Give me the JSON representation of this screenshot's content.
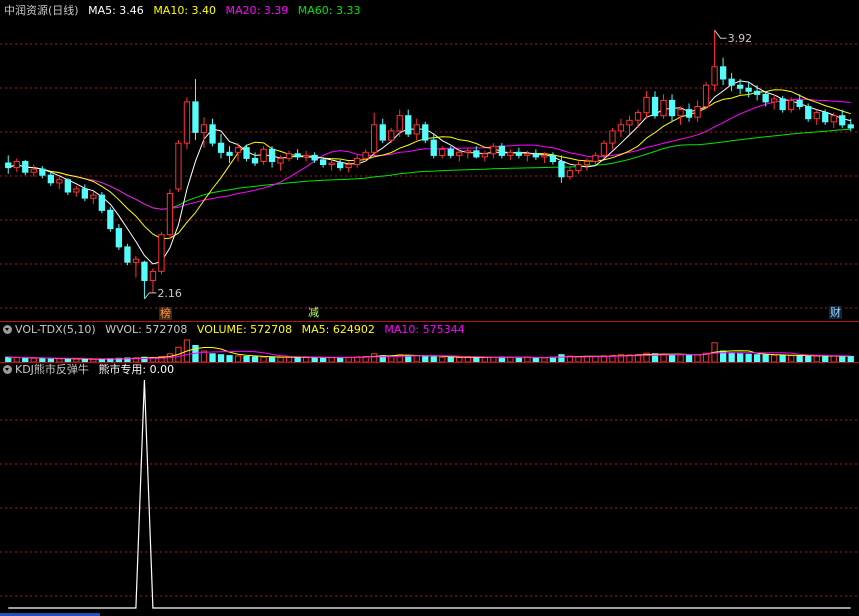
{
  "main": {
    "title": "中润资源(日线)",
    "ma5": "MA5: 3.46",
    "ma10": "MA10: 3.40",
    "ma20": "MA20: 3.39",
    "ma60": "MA60: 3.33",
    "high_label": "3.92",
    "low_label": "2.16",
    "events": [
      {
        "text": "榜"
      },
      {
        "text": "减"
      },
      {
        "text": "财"
      }
    ]
  },
  "volume": {
    "name": "VOL-TDX(5,10)",
    "wvol": "WVOL: 572708",
    "volume": "VOLUME: 572708",
    "ma5": "MA5: 624902",
    "ma10": "MA10: 575344"
  },
  "kdj": {
    "name": "KDJ熊市反弹牛",
    "line": "熊市专用: 0.00"
  },
  "colors": {
    "up": "#ff3232",
    "down": "#54fcfc",
    "ma5": "#ffffff",
    "ma10": "#ffff00",
    "ma20": "#ff00ff",
    "ma60": "#00e600",
    "grid": "#b41414"
  },
  "chart_data": {
    "type": "candlestick",
    "count": 100,
    "ohlc": [
      [
        3.05,
        3.1,
        2.98,
        3.02
      ],
      [
        3.02,
        3.08,
        2.99,
        3.06
      ],
      [
        3.06,
        3.07,
        2.97,
        2.99
      ],
      [
        2.99,
        3.04,
        2.96,
        3.01
      ],
      [
        3.01,
        3.03,
        2.95,
        2.97
      ],
      [
        2.97,
        2.99,
        2.9,
        2.92
      ],
      [
        2.92,
        2.96,
        2.88,
        2.94
      ],
      [
        2.94,
        2.95,
        2.84,
        2.86
      ],
      [
        2.86,
        2.9,
        2.83,
        2.88
      ],
      [
        2.88,
        2.91,
        2.8,
        2.82
      ],
      [
        2.82,
        2.86,
        2.78,
        2.84
      ],
      [
        2.84,
        2.86,
        2.72,
        2.74
      ],
      [
        2.74,
        2.76,
        2.6,
        2.62
      ],
      [
        2.62,
        2.65,
        2.48,
        2.5
      ],
      [
        2.5,
        2.52,
        2.38,
        2.4
      ],
      [
        2.4,
        2.44,
        2.3,
        2.42
      ],
      [
        2.4,
        2.41,
        2.16,
        2.28
      ],
      [
        2.28,
        2.36,
        2.2,
        2.34
      ],
      [
        2.34,
        2.6,
        2.32,
        2.58
      ],
      [
        2.58,
        2.88,
        2.55,
        2.85
      ],
      [
        2.88,
        3.2,
        2.86,
        3.18
      ],
      [
        3.18,
        3.48,
        3.14,
        3.45
      ],
      [
        3.45,
        3.6,
        3.2,
        3.25
      ],
      [
        3.25,
        3.35,
        3.15,
        3.3
      ],
      [
        3.3,
        3.34,
        3.16,
        3.18
      ],
      [
        3.18,
        3.24,
        3.08,
        3.12
      ],
      [
        3.12,
        3.16,
        3.05,
        3.1
      ],
      [
        3.12,
        3.18,
        3.06,
        3.15
      ],
      [
        3.15,
        3.17,
        3.06,
        3.08
      ],
      [
        3.08,
        3.12,
        3.03,
        3.05
      ],
      [
        3.06,
        3.16,
        3.04,
        3.14
      ],
      [
        3.14,
        3.16,
        3.02,
        3.06
      ],
      [
        3.05,
        3.1,
        3.0,
        3.08
      ],
      [
        3.08,
        3.13,
        3.06,
        3.11
      ],
      [
        3.11,
        3.14,
        3.07,
        3.09
      ],
      [
        3.09,
        3.13,
        3.06,
        3.1
      ],
      [
        3.1,
        3.12,
        3.05,
        3.07
      ],
      [
        3.07,
        3.09,
        3.02,
        3.04
      ],
      [
        3.04,
        3.08,
        3.0,
        3.05
      ],
      [
        3.05,
        3.07,
        3.0,
        3.02
      ],
      [
        3.02,
        3.06,
        2.99,
        3.04
      ],
      [
        3.04,
        3.1,
        3.02,
        3.08
      ],
      [
        3.08,
        3.14,
        3.06,
        3.12
      ],
      [
        3.12,
        3.38,
        3.1,
        3.3
      ],
      [
        3.3,
        3.34,
        3.18,
        3.2
      ],
      [
        3.2,
        3.28,
        3.18,
        3.26
      ],
      [
        3.26,
        3.4,
        3.22,
        3.36
      ],
      [
        3.36,
        3.4,
        3.22,
        3.24
      ],
      [
        3.24,
        3.34,
        3.2,
        3.3
      ],
      [
        3.3,
        3.32,
        3.18,
        3.2
      ],
      [
        3.2,
        3.24,
        3.08,
        3.1
      ],
      [
        3.1,
        3.16,
        3.08,
        3.14
      ],
      [
        3.14,
        3.16,
        3.08,
        3.1
      ],
      [
        3.1,
        3.14,
        3.06,
        3.12
      ],
      [
        3.12,
        3.15,
        3.08,
        3.13
      ],
      [
        3.13,
        3.16,
        3.08,
        3.09
      ],
      [
        3.09,
        3.13,
        3.06,
        3.11
      ],
      [
        3.11,
        3.18,
        3.08,
        3.16
      ],
      [
        3.16,
        3.18,
        3.08,
        3.1
      ],
      [
        3.1,
        3.14,
        3.07,
        3.12
      ],
      [
        3.12,
        3.15,
        3.08,
        3.1
      ],
      [
        3.1,
        3.13,
        3.06,
        3.11
      ],
      [
        3.11,
        3.14,
        3.07,
        3.09
      ],
      [
        3.09,
        3.12,
        3.05,
        3.1
      ],
      [
        3.1,
        3.12,
        3.04,
        3.06
      ],
      [
        3.06,
        3.1,
        2.92,
        2.96
      ],
      [
        2.96,
        3.02,
        2.94,
        3.0
      ],
      [
        3.0,
        3.06,
        2.98,
        3.04
      ],
      [
        3.04,
        3.08,
        3.0,
        3.06
      ],
      [
        3.06,
        3.12,
        3.04,
        3.1
      ],
      [
        3.1,
        3.2,
        3.08,
        3.18
      ],
      [
        3.18,
        3.28,
        3.14,
        3.26
      ],
      [
        3.26,
        3.34,
        3.22,
        3.3
      ],
      [
        3.3,
        3.36,
        3.24,
        3.33
      ],
      [
        3.33,
        3.4,
        3.28,
        3.38
      ],
      [
        3.38,
        3.52,
        3.34,
        3.48
      ],
      [
        3.48,
        3.52,
        3.34,
        3.36
      ],
      [
        3.36,
        3.5,
        3.34,
        3.46
      ],
      [
        3.46,
        3.5,
        3.32,
        3.36
      ],
      [
        3.36,
        3.42,
        3.3,
        3.4
      ],
      [
        3.4,
        3.44,
        3.32,
        3.35
      ],
      [
        3.35,
        3.46,
        3.32,
        3.42
      ],
      [
        3.42,
        3.58,
        3.4,
        3.56
      ],
      [
        3.56,
        3.92,
        3.52,
        3.68
      ],
      [
        3.68,
        3.74,
        3.56,
        3.6
      ],
      [
        3.6,
        3.64,
        3.52,
        3.56
      ],
      [
        3.56,
        3.6,
        3.5,
        3.54
      ],
      [
        3.54,
        3.58,
        3.48,
        3.52
      ],
      [
        3.52,
        3.56,
        3.46,
        3.5
      ],
      [
        3.5,
        3.52,
        3.42,
        3.45
      ],
      [
        3.45,
        3.5,
        3.4,
        3.47
      ],
      [
        3.47,
        3.49,
        3.38,
        3.4
      ],
      [
        3.4,
        3.48,
        3.38,
        3.46
      ],
      [
        3.46,
        3.5,
        3.4,
        3.42
      ],
      [
        3.42,
        3.44,
        3.32,
        3.34
      ],
      [
        3.34,
        3.4,
        3.3,
        3.38
      ],
      [
        3.38,
        3.4,
        3.3,
        3.32
      ],
      [
        3.32,
        3.38,
        3.28,
        3.36
      ],
      [
        3.36,
        3.4,
        3.28,
        3.3
      ],
      [
        3.3,
        3.34,
        3.26,
        3.28
      ]
    ],
    "volume": [
      52,
      48,
      44,
      40,
      38,
      36,
      35,
      34,
      33,
      32,
      31,
      30,
      36,
      40,
      44,
      46,
      52,
      50,
      60,
      90,
      160,
      240,
      180,
      120,
      90,
      80,
      70,
      66,
      60,
      56,
      54,
      52,
      50,
      54,
      52,
      50,
      48,
      46,
      48,
      50,
      52,
      56,
      60,
      90,
      70,
      64,
      80,
      72,
      70,
      60,
      56,
      52,
      50,
      48,
      50,
      52,
      50,
      54,
      52,
      50,
      48,
      50,
      48,
      46,
      52,
      80,
      64,
      58,
      56,
      60,
      66,
      72,
      80,
      76,
      80,
      96,
      90,
      86,
      80,
      78,
      74,
      80,
      96,
      210,
      120,
      100,
      90,
      84,
      80,
      76,
      74,
      72,
      70,
      68,
      66,
      64,
      62,
      66,
      64,
      60
    ],
    "kdj": [
      0,
      0,
      0,
      0,
      0,
      0,
      0,
      0,
      0,
      0,
      0,
      0,
      0,
      0,
      0,
      0,
      100,
      0,
      0,
      0,
      0,
      0,
      0,
      0,
      0,
      0,
      0,
      0,
      0,
      0,
      0,
      0,
      0,
      0,
      0,
      0,
      0,
      0,
      0,
      0,
      0,
      0,
      0,
      0,
      0,
      0,
      0,
      0,
      0,
      0,
      0,
      0,
      0,
      0,
      0,
      0,
      0,
      0,
      0,
      0,
      0,
      0,
      0,
      0,
      0,
      0,
      0,
      0,
      0,
      0,
      0,
      0,
      0,
      0,
      0,
      0,
      0,
      0,
      0,
      0,
      0,
      0,
      0,
      0,
      0,
      0,
      0,
      0,
      0,
      0,
      0,
      0,
      0,
      0,
      0,
      0,
      0,
      0,
      0,
      0
    ],
    "price_range": [
      2.1,
      4.0
    ],
    "kdj_range": [
      0,
      100
    ]
  }
}
